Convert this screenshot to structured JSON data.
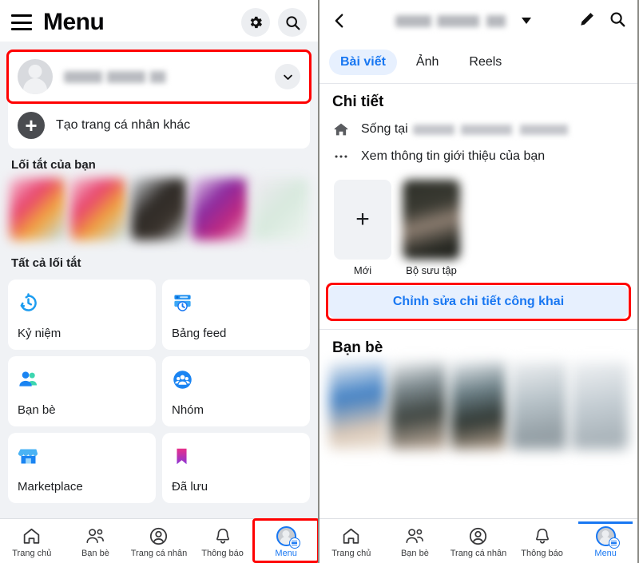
{
  "left": {
    "header": {
      "title": "Menu",
      "menu_icon": "hamburger-icon",
      "settings_icon": "gear-icon",
      "search_icon": "search-icon"
    },
    "profile": {
      "name_blurred": "",
      "chevron_icon": "chevron-down-icon",
      "highlighted": true,
      "highlight_color": "#ff0000"
    },
    "create_profile": {
      "label": "Tạo trang cá nhân khác",
      "icon": "plus-circle-icon"
    },
    "shortcuts_title": "Lối tắt của bạn",
    "shortcuts": [
      {
        "name": "shortcut-1",
        "color": "linear-gradient(135deg,#f7c6d9,#e8436f 35%,#f2a33c 62%,#bfe3ef)"
      },
      {
        "name": "shortcut-2",
        "color": "linear-gradient(135deg,#f6c9d8,#e8436f 35%,#f0a13b 62%,#c3e5f0)"
      },
      {
        "name": "shortcut-3",
        "color": "linear-gradient(135deg,#d9dde2,#2e2a26 40%,#3b342e 70%,#e6eaee)"
      },
      {
        "name": "shortcut-4",
        "color": "linear-gradient(135deg,#e9d6ef,#8a2aa0 38%,#c2297f 70%,#f0d9e6)"
      },
      {
        "name": "shortcut-5",
        "color": "linear-gradient(135deg,#f0eaf2,#d7e9dd 50%,#eef4f0)"
      }
    ],
    "all_shortcuts_title": "Tất cả lối tắt",
    "menu_items": [
      {
        "label": "Kỷ niệm",
        "icon": "clock-rewind-icon"
      },
      {
        "label": "Bảng feed",
        "icon": "feed-board-icon"
      },
      {
        "label": "Bạn bè",
        "icon": "friends-icon"
      },
      {
        "label": "Nhóm",
        "icon": "groups-icon"
      },
      {
        "label": "Marketplace",
        "icon": "storefront-icon"
      },
      {
        "label": "Đã lưu",
        "icon": "bookmark-icon"
      }
    ]
  },
  "right": {
    "header": {
      "back_icon": "back-chevron-icon",
      "name_blurred": "",
      "caret_icon": "caret-down-icon",
      "edit_icon": "pencil-icon",
      "search_icon": "search-icon"
    },
    "tabs": [
      {
        "label": "Bài viết",
        "active": true
      },
      {
        "label": "Ảnh",
        "active": false
      },
      {
        "label": "Reels",
        "active": false
      }
    ],
    "details": {
      "title": "Chi tiết",
      "lives_in_label": "Sống tại",
      "lives_in_value_blurred": "",
      "lives_in_icon": "house-icon",
      "see_about_label": "Xem thông tin giới thiệu của bạn",
      "see_about_icon": "ellipsis-icon"
    },
    "tiles": [
      {
        "label": "Mới",
        "type": "add",
        "icon": "plus-icon"
      },
      {
        "label": "Bộ sưu tập",
        "type": "photo",
        "icon": "collection-thumbnail"
      }
    ],
    "edit_public_button": {
      "label": "Chỉnh sửa chi tiết công khai",
      "highlighted": true,
      "highlight_color": "#ff0000",
      "text_color": "#1877f2"
    },
    "friends": {
      "title": "Bạn bè",
      "thumbs": [
        {
          "name": "friend-1",
          "color": "linear-gradient(170deg,#eef1f4,#3f7fc4 40%,#d9c7b6 75%,#efe7dd)"
        },
        {
          "name": "friend-2",
          "color": "linear-gradient(170deg,#f2f4f6,#7d8a8f 30%,#3d4440 60%,#cbb6a4)"
        },
        {
          "name": "friend-3",
          "color": "linear-gradient(170deg,#eceff2,#6b7f86 35%,#2f3733 65%,#bda894)"
        },
        {
          "name": "friend-4",
          "color": "linear-gradient(170deg,#eef0f2,#b7c2c8 45%,#95a0a6 80%)"
        },
        {
          "name": "friend-5",
          "color": "linear-gradient(170deg,#f0f2f4,#c3ccd2 50%,#aab4ba 85%)"
        }
      ]
    }
  },
  "bottom_nav": {
    "items": [
      {
        "label": "Trang chủ",
        "icon": "home-icon",
        "active": false
      },
      {
        "label": "Bạn bè",
        "icon": "friends-outline-icon",
        "active": false
      },
      {
        "label": "Trang cá nhân",
        "icon": "profile-circle-icon",
        "active": false
      },
      {
        "label": "Thông báo",
        "icon": "bell-icon",
        "active": false
      },
      {
        "label": "Menu",
        "icon": "menu-avatar-icon",
        "active": true
      }
    ],
    "active_color": "#1877f2",
    "left_menu_highlighted": true,
    "highlight_color": "#ff0000"
  }
}
